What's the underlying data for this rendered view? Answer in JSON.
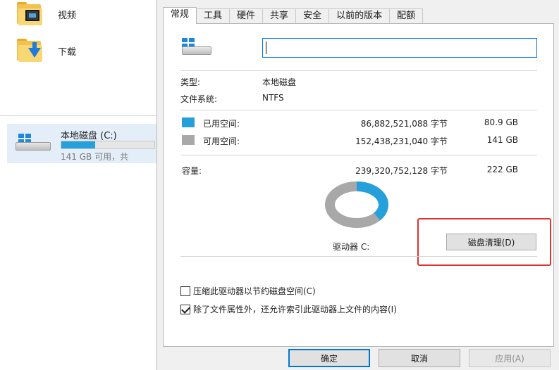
{
  "explorer": {
    "folders": [
      {
        "label": "视频",
        "icon": "video-folder-icon"
      },
      {
        "label": "下载",
        "icon": "download-folder-icon"
      }
    ],
    "drive": {
      "name": "本地磁盘 (C:)",
      "free_text": "141 GB 可用，共",
      "used_fraction": 0.363
    }
  },
  "dialog": {
    "tabs": [
      "常规",
      "工具",
      "硬件",
      "共享",
      "安全",
      "以前的版本",
      "配额"
    ],
    "active_tab": 0,
    "name_value": "",
    "type_label": "类型:",
    "type_value": "本地磁盘",
    "fs_label": "文件系统:",
    "fs_value": "NTFS",
    "used": {
      "label": "已用空间:",
      "bytes": "86,882,521,088 字节",
      "gb": "80.9 GB",
      "color": "#26a0da"
    },
    "free": {
      "label": "可用空间:",
      "bytes": "152,438,231,040 字节",
      "gb": "141 GB",
      "color": "#a8a8a8"
    },
    "capacity": {
      "label": "容量:",
      "bytes": "239,320,752,128 字节",
      "gb": "222 GB"
    },
    "drive_label": "驱动器 C:",
    "cleanup_button": "磁盘清理(D)",
    "compress_label": "压缩此驱动器以节约磁盘空间(C)",
    "compress_checked": false,
    "index_label": "除了文件属性外，还允许索引此驱动器上文件的内容(I)",
    "index_checked": true,
    "buttons": {
      "ok": "确定",
      "cancel": "取消",
      "apply": "应用(A)"
    }
  }
}
